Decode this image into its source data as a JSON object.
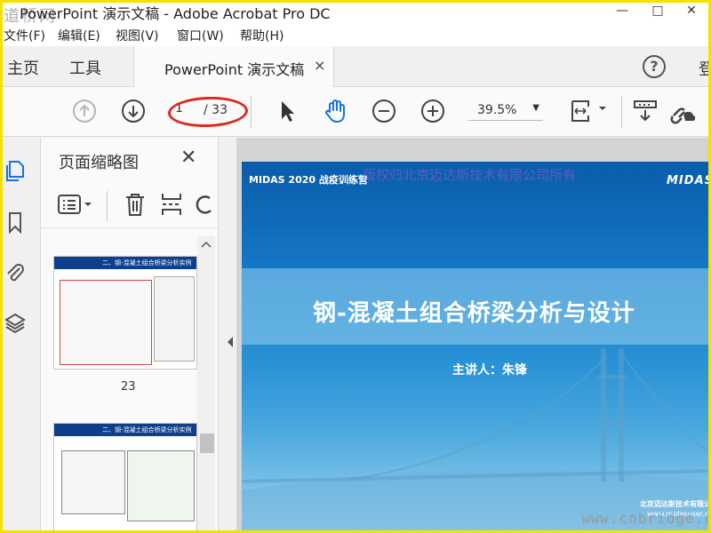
{
  "window": {
    "title": "PowerPoint 演示文稿 - Adobe Acrobat Pro DC",
    "watermark_top": "道桥网",
    "controls": [
      "—",
      "□",
      "✕"
    ]
  },
  "menu": [
    "文件(F)",
    "编辑(E)",
    "视图(V)",
    "窗口(W)",
    "帮助(H)"
  ],
  "tabs": {
    "home": "主页",
    "tools": "工具",
    "document": "PowerPoint 演示文稿",
    "close": "×",
    "help": "?",
    "signin": "登"
  },
  "toolbar": {
    "current_page": "1",
    "total_pages": "/ 33",
    "zoom": "39.5%",
    "caret": "▼"
  },
  "thumbnails_panel": {
    "title": "页面缩略图",
    "close": "✕",
    "pages": [
      {
        "number": "23",
        "heading": "二、钢-混凝土组合桥梁分析实例"
      },
      {
        "number": "",
        "heading": "二、钢-混凝土组合桥梁分析实例"
      }
    ]
  },
  "slide": {
    "header": "MIDAS 2020 战疫训练营",
    "watermark": "版权归北京迈达斯技术有限公司所有",
    "logo": "MIDAS",
    "title": "钢-混凝土组合桥梁分析与设计",
    "speaker": "主讲人：朱锋",
    "company": "北京迈达斯技术有限公司",
    "url": "www.midasuser.com"
  },
  "corner_watermark": "www.cnbridge.cn",
  "colors": {
    "accent_oval": "#e0271d",
    "slide_blue": "#1578c7",
    "selected_icon": "#1473e6",
    "frame": "#f5e100"
  }
}
